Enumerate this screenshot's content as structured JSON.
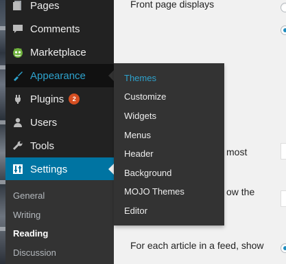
{
  "sidebar": {
    "items": [
      {
        "label": "Pages",
        "icon": "pages-icon"
      },
      {
        "label": "Comments",
        "icon": "comments-icon"
      },
      {
        "label": "Marketplace",
        "icon": "marketplace-icon"
      },
      {
        "label": "Appearance",
        "icon": "appearance-icon"
      },
      {
        "label": "Plugins",
        "icon": "plugins-icon",
        "badge": "2"
      },
      {
        "label": "Users",
        "icon": "users-icon"
      },
      {
        "label": "Tools",
        "icon": "tools-icon"
      },
      {
        "label": "Settings",
        "icon": "settings-icon"
      }
    ],
    "submenu": [
      "General",
      "Writing",
      "Reading",
      "Discussion"
    ],
    "active_submenu": "Reading"
  },
  "flyout": {
    "items": [
      "Themes",
      "Customize",
      "Widgets",
      "Menus",
      "Header",
      "Background",
      "MOJO Themes",
      "Editor"
    ],
    "active": "Themes"
  },
  "main": {
    "front_page_label": "Front page displays",
    "partial_text_1": "most",
    "partial_text_2": "ow the",
    "feed_label": "For each article in a feed, show"
  },
  "colors": {
    "sidebar_bg": "#222222",
    "submenu_bg": "#333333",
    "current_bg": "#0074a2",
    "highlight_text": "#2ea2cc",
    "badge_bg": "#d54e21"
  }
}
